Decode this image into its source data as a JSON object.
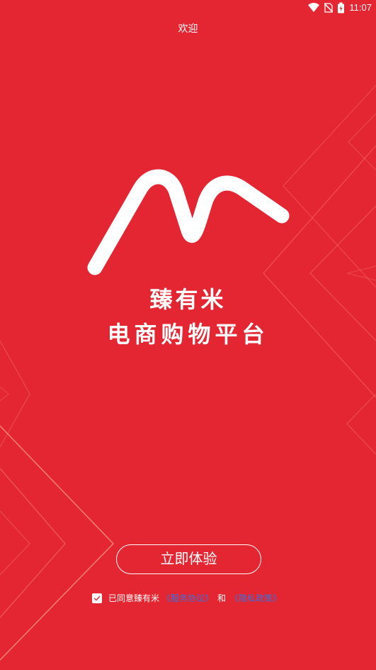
{
  "status_bar": {
    "time": "11:07",
    "icons": [
      "wifi-icon",
      "no-sim-icon",
      "battery-charging-icon"
    ]
  },
  "header": {
    "title": "欢迎"
  },
  "brand": {
    "logo_icon": "brand-m-logo-icon",
    "name": "臻有米",
    "tagline": "电商购物平台"
  },
  "actions": {
    "start_label": "立即体验"
  },
  "agreement": {
    "checked": true,
    "prefix": "已同意臻有米",
    "service_link": "《服务协议》",
    "and": "和",
    "privacy_link": "《隐私政策》"
  },
  "colors": {
    "background": "#e42532",
    "link": "#3f6fd8",
    "text": "#ffffff"
  }
}
